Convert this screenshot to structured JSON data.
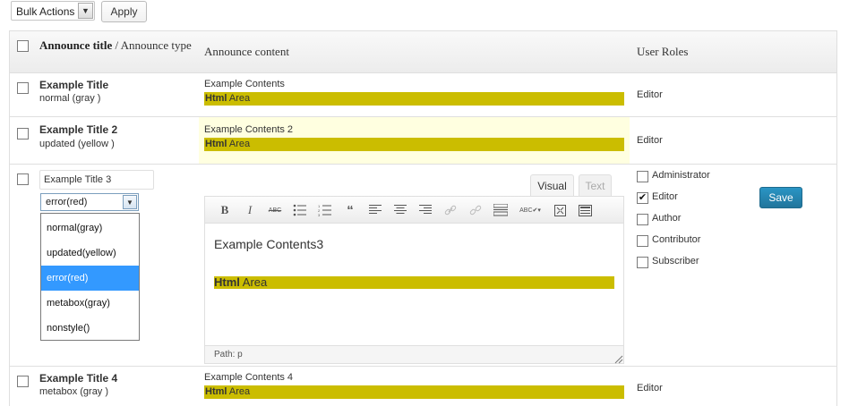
{
  "toolbar": {
    "bulk_actions": "Bulk Actions",
    "apply_label": "Apply"
  },
  "table": {
    "header": {
      "title_bold": "Announce title",
      "title_sep": " / ",
      "title_type": "Announce type",
      "content": "Announce content",
      "roles": "User Roles"
    },
    "rows": [
      {
        "title": "Example Title",
        "type": "normal (gray )",
        "content": "Example Contents",
        "html_bold": "Html",
        "html_rest": " Area",
        "role": "Editor"
      },
      {
        "title": "Example Title 2",
        "type": "updated (yellow )",
        "content": "Example Contents 2",
        "html_bold": "Html",
        "html_rest": " Area",
        "role": "Editor"
      },
      {
        "title": "Example Title 4",
        "type": "metabox (gray )",
        "content": "Example Contents 4",
        "html_bold": "Html",
        "html_rest": " Area",
        "role": "Editor"
      }
    ],
    "edit_row": {
      "title_value": "Example Title 3",
      "type_selected": "error(red)",
      "type_options": [
        "normal(gray)",
        "updated(yellow)",
        "error(red)",
        "metabox(gray)",
        "nonstyle()"
      ],
      "editor": {
        "tab_visual": "Visual",
        "tab_text": "Text",
        "body_line": "Example Contents3",
        "html_bold": "Html",
        "html_rest": " Area",
        "status_path": "Path: p"
      },
      "roles": [
        {
          "label": "Administrator",
          "checked": false
        },
        {
          "label": "Editor",
          "checked": true
        },
        {
          "label": "Author",
          "checked": false
        },
        {
          "label": "Contributor",
          "checked": false
        },
        {
          "label": "Subscriber",
          "checked": false
        }
      ],
      "save_label": "Save"
    }
  },
  "colors": {
    "html_highlight": "#cbbd00",
    "updated_row_bg": "#ffffe0",
    "selected_option": "#3399ff",
    "save_button": "#21759b"
  }
}
